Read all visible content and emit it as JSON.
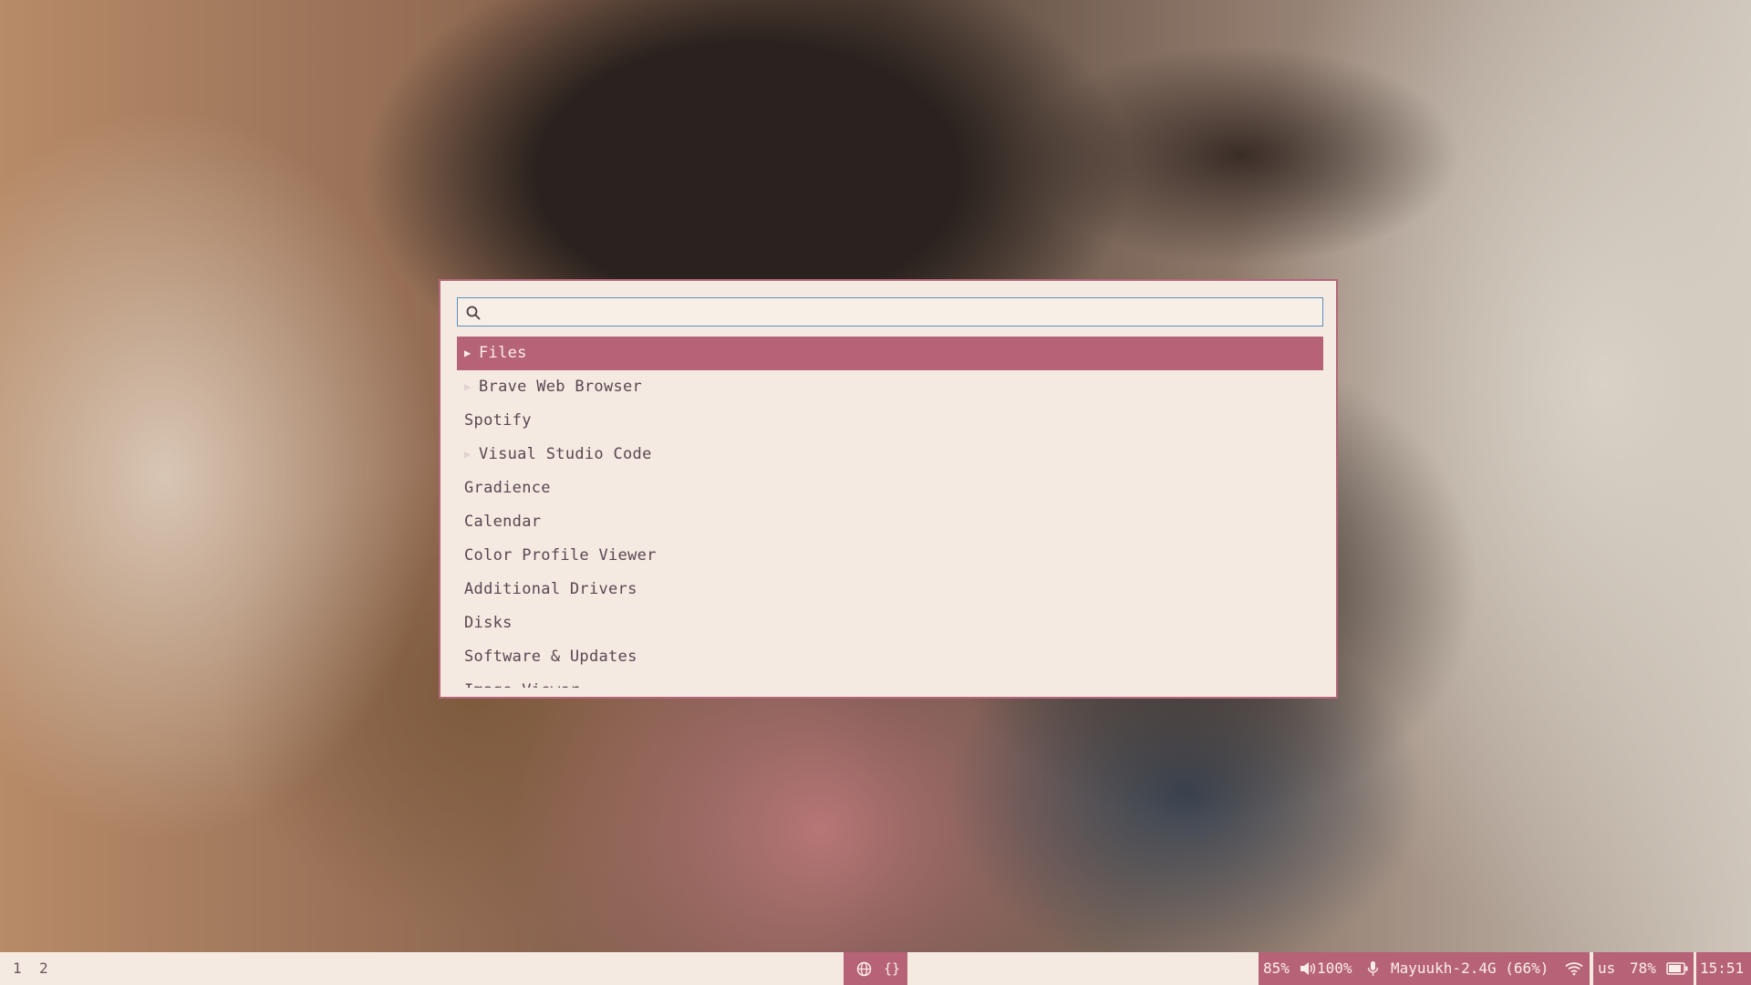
{
  "search": {
    "value": "",
    "placeholder": ""
  },
  "apps": [
    {
      "label": "Files",
      "selected": true,
      "has_arrow": true
    },
    {
      "label": "Brave Web Browser",
      "selected": false,
      "has_arrow": true
    },
    {
      "label": "Spotify",
      "selected": false,
      "has_arrow": false
    },
    {
      "label": "Visual Studio Code",
      "selected": false,
      "has_arrow": true
    },
    {
      "label": "Gradience",
      "selected": false,
      "has_arrow": false
    },
    {
      "label": "Calendar",
      "selected": false,
      "has_arrow": false
    },
    {
      "label": "Color Profile Viewer",
      "selected": false,
      "has_arrow": false
    },
    {
      "label": "Additional Drivers",
      "selected": false,
      "has_arrow": false
    },
    {
      "label": "Disks",
      "selected": false,
      "has_arrow": false
    },
    {
      "label": "Software & Updates",
      "selected": false,
      "has_arrow": false
    },
    {
      "label": "Image Viewer",
      "selected": false,
      "has_arrow": false
    }
  ],
  "taskbar": {
    "workspaces": [
      "1",
      "2"
    ],
    "center_icons": [
      "globe-icon",
      "braces-icon"
    ],
    "brightness": "85%",
    "volume": "100%",
    "wifi": "Mayuukh-2.4G (66%)",
    "keyboard_layout": "us",
    "battery": "78%",
    "clock": "15:51"
  },
  "colors": {
    "accent": "#b66377",
    "panel_bg": "#f4eae1",
    "search_border": "#5a8ec2",
    "text": "#5a4652"
  }
}
